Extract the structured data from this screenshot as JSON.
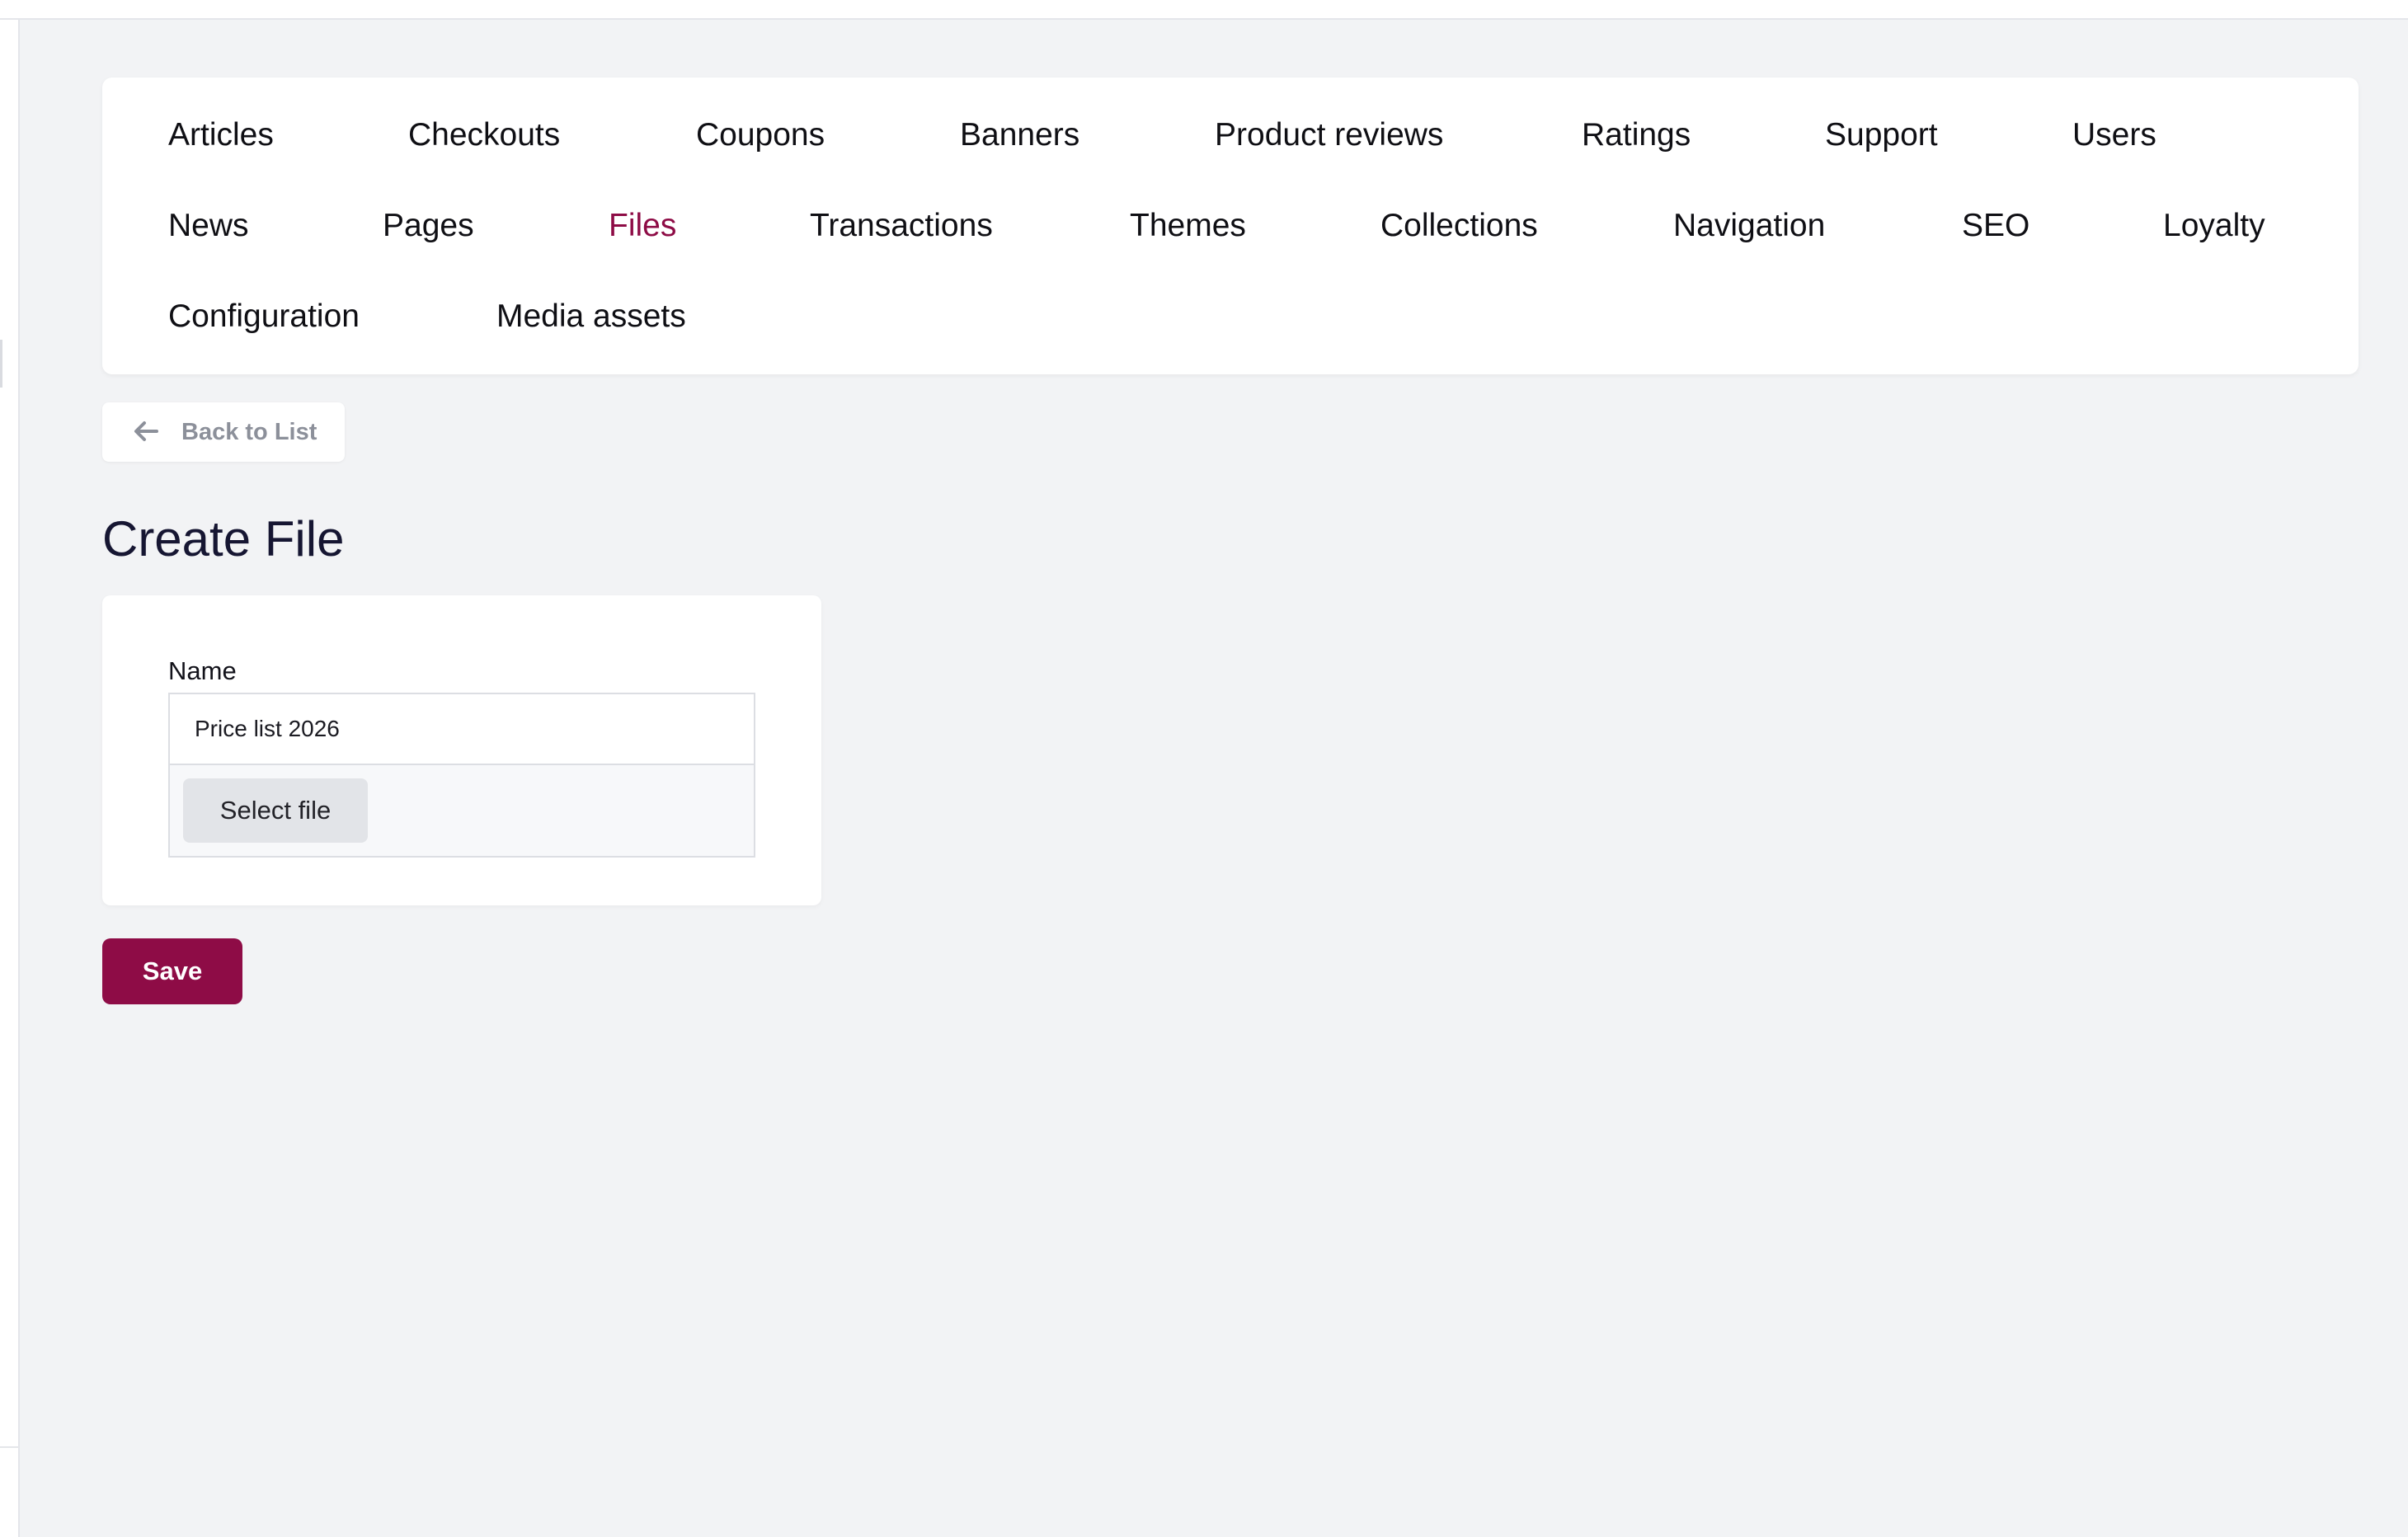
{
  "nav": {
    "items": [
      {
        "label": "Articles",
        "active": false
      },
      {
        "label": "Checkouts",
        "active": false
      },
      {
        "label": "Coupons",
        "active": false
      },
      {
        "label": "Banners",
        "active": false
      },
      {
        "label": "Product reviews",
        "active": false
      },
      {
        "label": "Ratings",
        "active": false
      },
      {
        "label": "Support",
        "active": false
      },
      {
        "label": "Users",
        "active": false
      },
      {
        "label": "News",
        "active": false
      },
      {
        "label": "Pages",
        "active": false
      },
      {
        "label": "Files",
        "active": true
      },
      {
        "label": "Transactions",
        "active": false
      },
      {
        "label": "Themes",
        "active": false
      },
      {
        "label": "Collections",
        "active": false
      },
      {
        "label": "Navigation",
        "active": false
      },
      {
        "label": "SEO",
        "active": false
      },
      {
        "label": "Loyalty",
        "active": false
      },
      {
        "label": "Configuration",
        "active": false
      },
      {
        "label": "Media assets",
        "active": false
      }
    ]
  },
  "back_button": {
    "label": "Back to List",
    "icon": "arrow-left-icon"
  },
  "page": {
    "title": "Create File"
  },
  "form": {
    "name_label": "Name",
    "name_value": "Price list 2026",
    "file_button_label": "Select file"
  },
  "actions": {
    "save_label": "Save"
  },
  "colors": {
    "accent": "#8e0c46",
    "background": "#f2f3f5",
    "card": "#ffffff"
  }
}
